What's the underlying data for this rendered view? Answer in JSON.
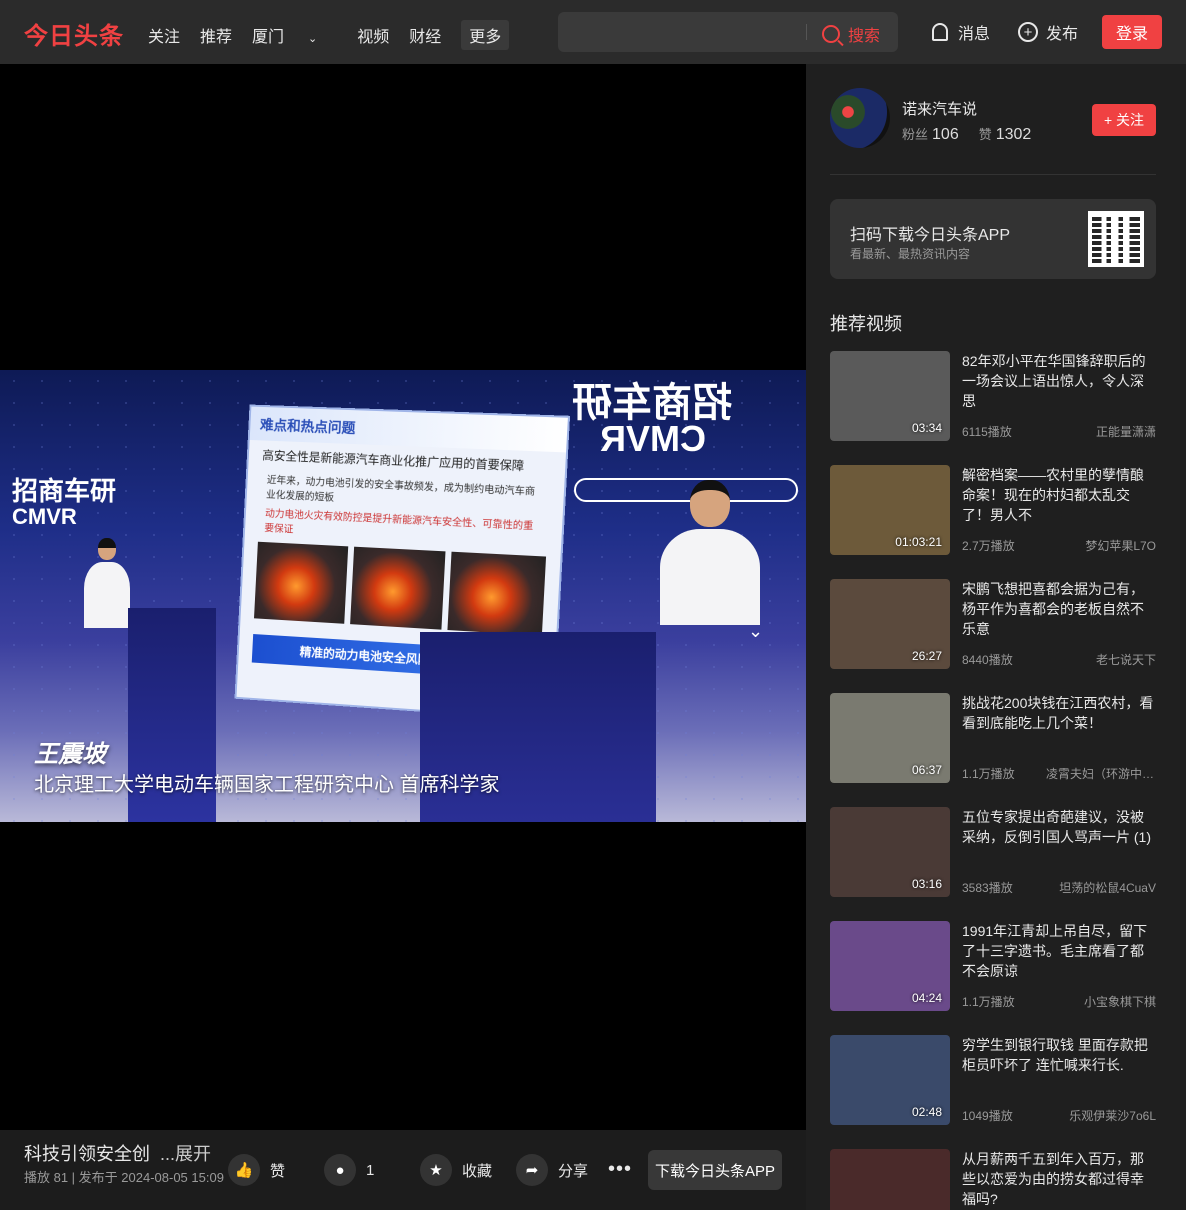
{
  "header": {
    "logo": "今日头条",
    "nav": [
      "关注",
      "推荐",
      "厦门",
      "视频",
      "财经"
    ],
    "more": "更多",
    "search_placeholder": "",
    "search_btn": "搜索",
    "messages": "消息",
    "publish": "发布",
    "login": "登录"
  },
  "video": {
    "caption_name": "王震坡",
    "caption_sub": "北京理工大学电动车辆国家工程研究中心 首席科学家",
    "slide_heading": "难点和热点问题",
    "slide_point": "高安全性是新能源汽车商业化推广应用的首要保障",
    "slide_line1": "近年来，动力电池引发的安全事故频发，成为制约电动汽车商业化发展的短板",
    "slide_line2": "动力电池火灾有效防控是提升新能源汽车安全性、可靠性的重要保证",
    "slide_banner": "精准的动力电池安全风险预测与防控",
    "brand_left": "招商车研",
    "brand_left_en": "CMVR",
    "brand_right": "招商车研",
    "brand_right_en": "CMVR"
  },
  "bottom": {
    "title": "科技引领安全创",
    "expand": "...展开",
    "meta": "播放 81 | 发布于 2024-08-05 15:09",
    "like": "赞",
    "comment_count": "1",
    "collect": "收藏",
    "share": "分享",
    "download": "下载今日头条APP"
  },
  "author": {
    "name": "诺来汽车说",
    "fans_label": "粉丝",
    "fans": "106",
    "likes_label": "赞",
    "likes": "1302",
    "follow": "+ 关注"
  },
  "appcard": {
    "title": "扫码下载今日头条APP",
    "subtitle": "看最新、最热资讯内容"
  },
  "recommend": {
    "title": "推荐视频",
    "items": [
      {
        "title": "82年邓小平在华国锋辞职后的一场会议上语出惊人，令人深思",
        "duration": "03:34",
        "plays": "6115播放",
        "author": "正能量潇潇",
        "color": "#5a5a5a"
      },
      {
        "title": "解密档案——农村里的孽情酿命案！现在的村妇都太乱交了！男人不",
        "duration": "01:03:21",
        "plays": "2.7万播放",
        "author": "梦幻苹果L7O",
        "color": "#6d5a3a"
      },
      {
        "title": "宋鹏飞想把喜都会据为己有，杨平作为喜都会的老板自然不乐意",
        "duration": "26:27",
        "plays": "8440播放",
        "author": "老七说天下",
        "color": "#5b4a3d"
      },
      {
        "title": "挑战花200块钱在江西农村，看看到底能吃上几个菜！",
        "duration": "06:37",
        "plays": "1.1万播放",
        "author": "凌霄夫妇（环游中国）",
        "color": "#7a7a70"
      },
      {
        "title": "五位专家提出奇葩建议，没被采纳，反倒引国人骂声一片 (1)",
        "duration": "03:16",
        "plays": "3583播放",
        "author": "坦荡的松鼠4CuaV",
        "color": "#4a3a36"
      },
      {
        "title": "1991年江青却上吊自尽，留下了十三字遗书。毛主席看了都不会原谅",
        "duration": "04:24",
        "plays": "1.1万播放",
        "author": "小宝象棋下棋",
        "color": "#6a4a8a"
      },
      {
        "title": "穷学生到银行取钱 里面存款把柜员吓坏了 连忙喊来行长.",
        "duration": "02:48",
        "plays": "1049播放",
        "author": "乐观伊莱沙7o6L",
        "color": "#3a4a6a"
      },
      {
        "title": "从月薪两千五到年入百万，那些以恋爱为由的捞女都过得幸福吗?",
        "duration": "",
        "plays": "",
        "author": "",
        "color": "#4a2a2a"
      }
    ]
  }
}
